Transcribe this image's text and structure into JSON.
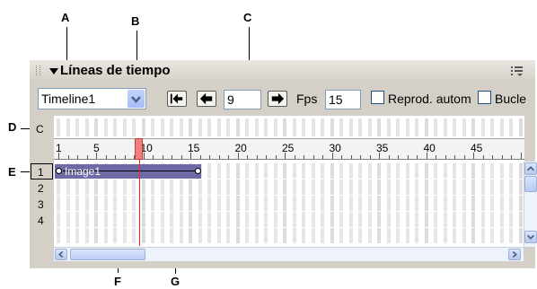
{
  "callouts": {
    "A": "A",
    "B": "B",
    "C": "C",
    "D": "D",
    "E": "E",
    "F": "F",
    "G": "G"
  },
  "panel": {
    "title": "Líneas de tiempo",
    "toolbar": {
      "timeline_select": "Timeline1",
      "frame_value": "9",
      "fps_label": "Fps",
      "fps_value": "15",
      "autoplay_label": "Reprod. autom",
      "loop_label": "Bucle"
    },
    "behavior_channel_label": "C",
    "ruler_numbers": [
      "1",
      "5",
      "10",
      "15",
      "20",
      "25",
      "30",
      "35",
      "40",
      "45"
    ],
    "rows": [
      "1",
      "2",
      "3",
      "4"
    ],
    "animation_bar_label": "Image1"
  },
  "icons": [
    "panel-grip-icon",
    "collapse-triangle-icon",
    "options-menu-icon",
    "dropdown-arrow-icon",
    "rewind-icon",
    "back-icon",
    "play-forward-icon",
    "scroll-up-icon",
    "scroll-down-icon",
    "scroll-left-icon",
    "scroll-right-icon"
  ],
  "colors": {
    "bar": "#6f6aa6",
    "playhead": "#f08080",
    "panel": "#d4d0c8"
  }
}
